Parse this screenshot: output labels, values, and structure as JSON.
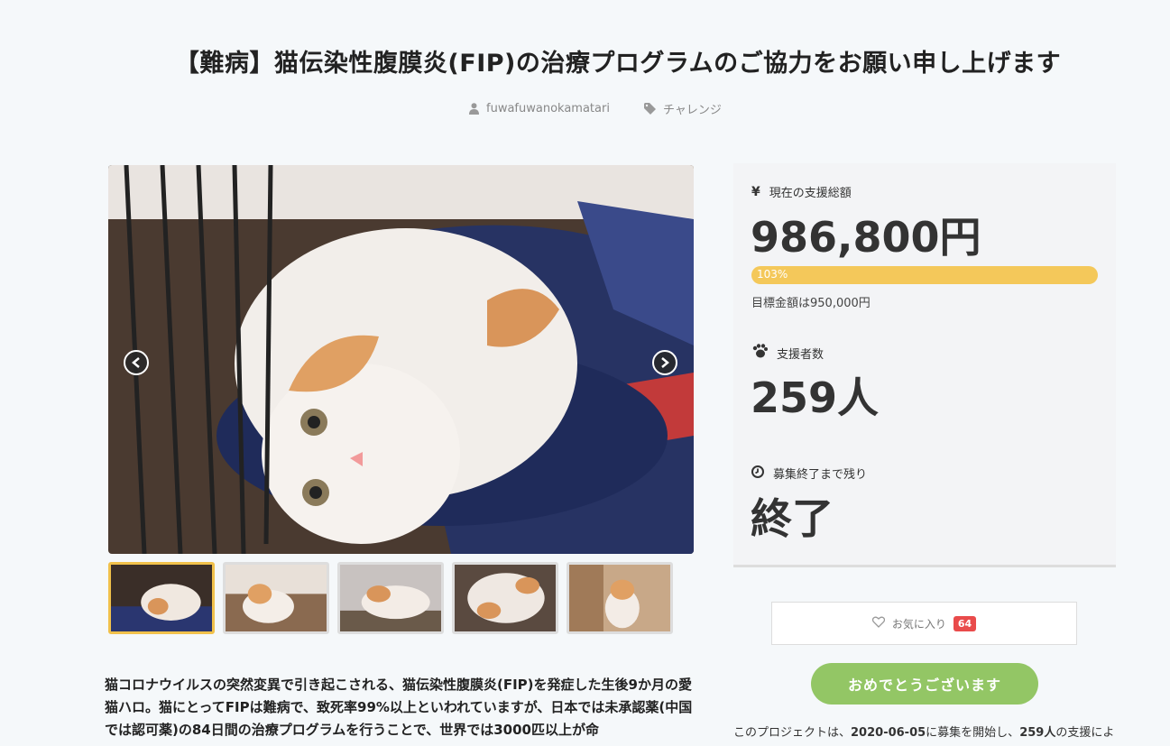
{
  "project": {
    "title": "【難病】猫伝染性腹膜炎(FIP)の治療プログラムのご協力をお願い申し上げます",
    "author": "fuwafuwanokamatari",
    "category": "チャレンジ"
  },
  "gallery": {
    "main_image": "cat-photo",
    "thumbnails": [
      "cat-photo-1",
      "cat-photo-2",
      "cat-photo-3",
      "cat-photo-4",
      "cat-photo-5"
    ],
    "active_index": 0
  },
  "description": "猫コロナウイルスの突然変異で引き起こされる、猫伝染性腹膜炎(FIP)を発症した生後9か月の愛猫ハロ。猫にとってFIPは難病で、致死率99%以上といわれていますが、日本では未承認薬(中国では認可薬)の84日間の治療プログラムを行うことで、世界では3000匹以上が命",
  "stats": {
    "funded_label": "現在の支援総額",
    "funded_amount": "986,800円",
    "progress_label": "103%",
    "progress_fraction": 1.03,
    "goal_text": "目標金額は950,000円",
    "backers_label": "支援者数",
    "backers_count": "259人",
    "remaining_label": "募集終了まで残り",
    "remaining_value": "終了",
    "currency_icon": "yen-icon",
    "backers_icon": "paw-icon",
    "time_icon": "clock-icon"
  },
  "actions": {
    "favorite_label": "お気に入り",
    "favorite_count": "64",
    "congrats_label": "おめでとうございます"
  },
  "footer_note": {
    "pre": "このプロジェクトは、",
    "date": "2020-06-05",
    "mid": "に募集を開始し、",
    "backers": "259人",
    "post": "の支援によ"
  },
  "colors": {
    "accent": "#f4c85a",
    "congrats": "#93c665",
    "badge": "#e94b4b"
  }
}
